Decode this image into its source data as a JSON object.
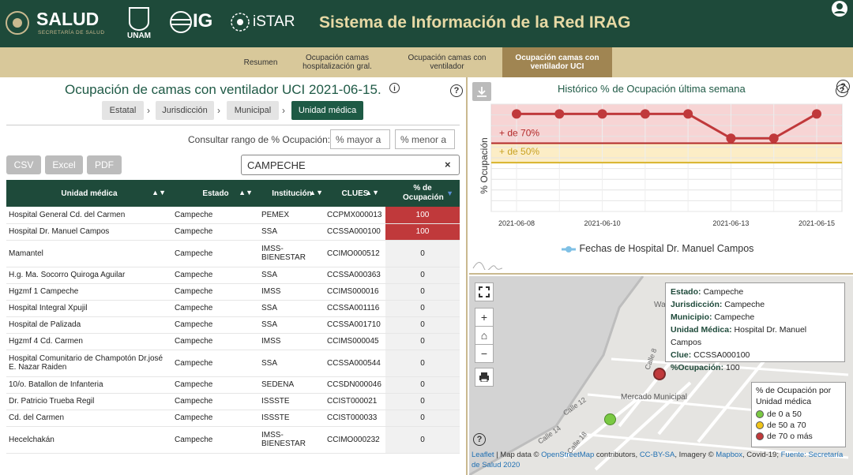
{
  "header": {
    "title": "Sistema de Información de la Red IRAG",
    "logos": {
      "salud_main": "SALUD",
      "salud_sub": "SECRETARÍA DE SALUD",
      "unam": "UNAM",
      "ig": "IG",
      "istar": "iSTAR"
    }
  },
  "tabs": [
    {
      "label": "Resumen"
    },
    {
      "label": "Ocupación camas hospitalización gral."
    },
    {
      "label": "Ocupación camas con ventilador"
    },
    {
      "label": "Ocupación camas con ventilador UCI"
    }
  ],
  "page": {
    "title": "Ocupación de camas con ventilador UCI 2021-06-15."
  },
  "breadcrumb": [
    "Estatal",
    "Jurisdicción",
    "Municipal",
    "Unidad médica"
  ],
  "range": {
    "label": "Consultar rango de % Ocupación:",
    "min_placeholder": "% mayor a",
    "max_placeholder": "% menor a"
  },
  "export": {
    "csv": "CSV",
    "excel": "Excel",
    "pdf": "PDF"
  },
  "search": {
    "value": "CAMPECHE",
    "clear": "×"
  },
  "table": {
    "headers": [
      "Unidad médica",
      "Estado",
      "Institución",
      "CLUES",
      "% de Ocupación"
    ],
    "rows": [
      [
        "Hospital General Cd. del Carmen",
        "Campeche",
        "PEMEX",
        "CCPMX000013",
        "100"
      ],
      [
        "Hospital Dr. Manuel Campos",
        "Campeche",
        "SSA",
        "CCSSA000100",
        "100"
      ],
      [
        "Mamantel",
        "Campeche",
        "IMSS-BIENESTAR",
        "CCIMO000512",
        "0"
      ],
      [
        "H.g. Ma. Socorro Quiroga Aguilar",
        "Campeche",
        "SSA",
        "CCSSA000363",
        "0"
      ],
      [
        "Hgzmf 1 Campeche",
        "Campeche",
        "IMSS",
        "CCIMS000016",
        "0"
      ],
      [
        "Hospital Integral Xpujil",
        "Campeche",
        "SSA",
        "CCSSA001116",
        "0"
      ],
      [
        "Hospital de Palizada",
        "Campeche",
        "SSA",
        "CCSSA001710",
        "0"
      ],
      [
        "Hgzmf 4 Cd. Carmen",
        "Campeche",
        "IMSS",
        "CCIMS000045",
        "0"
      ],
      [
        "Hospital Comunitario de Champotón Dr.josé E. Nazar Raiden",
        "Campeche",
        "SSA",
        "CCSSA000544",
        "0"
      ],
      [
        "10/o. Batallon de Infanteria",
        "Campeche",
        "SEDENA",
        "CCSDN000046",
        "0"
      ],
      [
        "Dr. Patricio Trueba Regil",
        "Campeche",
        "ISSSTE",
        "CCIST000021",
        "0"
      ],
      [
        "Cd. del Carmen",
        "Campeche",
        "ISSSTE",
        "CCIST000033",
        "0"
      ],
      [
        "Hecelchakán",
        "Campeche",
        "IMSS-BIENESTAR",
        "CCIMO000232",
        "0"
      ]
    ]
  },
  "chart_data": {
    "type": "line",
    "title": "Histórico % de Ocupación última semana",
    "ylabel": "% Ocupación",
    "x": [
      "2021-06-08",
      "2021-06-09",
      "2021-06-10",
      "2021-06-11",
      "2021-06-12",
      "2021-06-13",
      "2021-06-14",
      "2021-06-15"
    ],
    "xticks": [
      "2021-06-08",
      "2021-06-10",
      "2021-06-13",
      "2021-06-15"
    ],
    "series": [
      {
        "name": "Fechas de Hospital Dr. Manuel Campos",
        "values": [
          100,
          100,
          100,
          100,
          100,
          75,
          75,
          100
        ],
        "color": "#c0393b"
      }
    ],
    "bands": [
      {
        "label": "+ de 70%",
        "from": 70,
        "color": "#f3c2c2"
      },
      {
        "label": "+ de 50%",
        "from": 50,
        "color": "#fbe9b8"
      }
    ],
    "ylim": [
      0,
      110
    ],
    "grid": true
  },
  "map": {
    "info": {
      "estado_label": "Estado:",
      "estado": "Campeche",
      "jur_label": "Jurisdicción:",
      "jur": "Campeche",
      "mun_label": "Municipio:",
      "mun": "Campeche",
      "unidad_label": "Unidad Médica:",
      "unidad": "Hospital Dr. Manuel Campos",
      "clue_label": "Clue:",
      "clue": "CCSSA000100",
      "ocup_label": "%Ocupación:",
      "ocup": "100"
    },
    "legend": {
      "title": "% de Ocupación por Unidad médica",
      "items": [
        "de 0 a 50",
        "de 50 a 70",
        "de 70 o más"
      ],
      "colors": [
        "#7ac943",
        "#f0c419",
        "#c0393b"
      ]
    },
    "labels": [
      "Mercado Municipal",
      "Calle 12",
      "Calle 14",
      "Calle 18",
      "Calle 8",
      "Wa"
    ],
    "attribution": {
      "leaflet": "Leaflet",
      "t1": " | Map data © ",
      "osm": "OpenStreetMap",
      "t2": " contributors, ",
      "cc": "CC-BY-SA",
      "t3": ", Imagery © ",
      "mapbox": "Mapbox",
      "t4": ", Covid-19; ",
      "fuente": "Fuente: Secretaría de Salud 2020"
    }
  }
}
